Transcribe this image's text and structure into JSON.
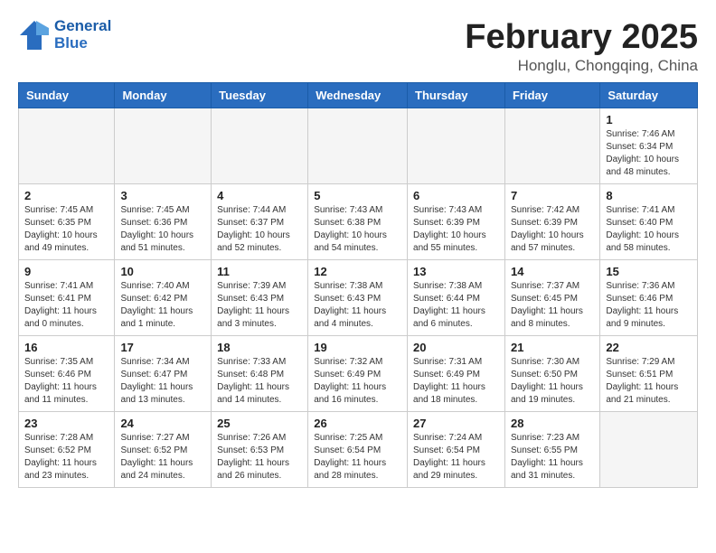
{
  "logo": {
    "line1": "General",
    "line2": "Blue"
  },
  "title": "February 2025",
  "subtitle": "Honglu, Chongqing, China",
  "days_of_week": [
    "Sunday",
    "Monday",
    "Tuesday",
    "Wednesday",
    "Thursday",
    "Friday",
    "Saturday"
  ],
  "weeks": [
    [
      {
        "num": "",
        "info": ""
      },
      {
        "num": "",
        "info": ""
      },
      {
        "num": "",
        "info": ""
      },
      {
        "num": "",
        "info": ""
      },
      {
        "num": "",
        "info": ""
      },
      {
        "num": "",
        "info": ""
      },
      {
        "num": "1",
        "info": "Sunrise: 7:46 AM\nSunset: 6:34 PM\nDaylight: 10 hours\nand 48 minutes."
      }
    ],
    [
      {
        "num": "2",
        "info": "Sunrise: 7:45 AM\nSunset: 6:35 PM\nDaylight: 10 hours\nand 49 minutes."
      },
      {
        "num": "3",
        "info": "Sunrise: 7:45 AM\nSunset: 6:36 PM\nDaylight: 10 hours\nand 51 minutes."
      },
      {
        "num": "4",
        "info": "Sunrise: 7:44 AM\nSunset: 6:37 PM\nDaylight: 10 hours\nand 52 minutes."
      },
      {
        "num": "5",
        "info": "Sunrise: 7:43 AM\nSunset: 6:38 PM\nDaylight: 10 hours\nand 54 minutes."
      },
      {
        "num": "6",
        "info": "Sunrise: 7:43 AM\nSunset: 6:39 PM\nDaylight: 10 hours\nand 55 minutes."
      },
      {
        "num": "7",
        "info": "Sunrise: 7:42 AM\nSunset: 6:39 PM\nDaylight: 10 hours\nand 57 minutes."
      },
      {
        "num": "8",
        "info": "Sunrise: 7:41 AM\nSunset: 6:40 PM\nDaylight: 10 hours\nand 58 minutes."
      }
    ],
    [
      {
        "num": "9",
        "info": "Sunrise: 7:41 AM\nSunset: 6:41 PM\nDaylight: 11 hours\nand 0 minutes."
      },
      {
        "num": "10",
        "info": "Sunrise: 7:40 AM\nSunset: 6:42 PM\nDaylight: 11 hours\nand 1 minute."
      },
      {
        "num": "11",
        "info": "Sunrise: 7:39 AM\nSunset: 6:43 PM\nDaylight: 11 hours\nand 3 minutes."
      },
      {
        "num": "12",
        "info": "Sunrise: 7:38 AM\nSunset: 6:43 PM\nDaylight: 11 hours\nand 4 minutes."
      },
      {
        "num": "13",
        "info": "Sunrise: 7:38 AM\nSunset: 6:44 PM\nDaylight: 11 hours\nand 6 minutes."
      },
      {
        "num": "14",
        "info": "Sunrise: 7:37 AM\nSunset: 6:45 PM\nDaylight: 11 hours\nand 8 minutes."
      },
      {
        "num": "15",
        "info": "Sunrise: 7:36 AM\nSunset: 6:46 PM\nDaylight: 11 hours\nand 9 minutes."
      }
    ],
    [
      {
        "num": "16",
        "info": "Sunrise: 7:35 AM\nSunset: 6:46 PM\nDaylight: 11 hours\nand 11 minutes."
      },
      {
        "num": "17",
        "info": "Sunrise: 7:34 AM\nSunset: 6:47 PM\nDaylight: 11 hours\nand 13 minutes."
      },
      {
        "num": "18",
        "info": "Sunrise: 7:33 AM\nSunset: 6:48 PM\nDaylight: 11 hours\nand 14 minutes."
      },
      {
        "num": "19",
        "info": "Sunrise: 7:32 AM\nSunset: 6:49 PM\nDaylight: 11 hours\nand 16 minutes."
      },
      {
        "num": "20",
        "info": "Sunrise: 7:31 AM\nSunset: 6:49 PM\nDaylight: 11 hours\nand 18 minutes."
      },
      {
        "num": "21",
        "info": "Sunrise: 7:30 AM\nSunset: 6:50 PM\nDaylight: 11 hours\nand 19 minutes."
      },
      {
        "num": "22",
        "info": "Sunrise: 7:29 AM\nSunset: 6:51 PM\nDaylight: 11 hours\nand 21 minutes."
      }
    ],
    [
      {
        "num": "23",
        "info": "Sunrise: 7:28 AM\nSunset: 6:52 PM\nDaylight: 11 hours\nand 23 minutes."
      },
      {
        "num": "24",
        "info": "Sunrise: 7:27 AM\nSunset: 6:52 PM\nDaylight: 11 hours\nand 24 minutes."
      },
      {
        "num": "25",
        "info": "Sunrise: 7:26 AM\nSunset: 6:53 PM\nDaylight: 11 hours\nand 26 minutes."
      },
      {
        "num": "26",
        "info": "Sunrise: 7:25 AM\nSunset: 6:54 PM\nDaylight: 11 hours\nand 28 minutes."
      },
      {
        "num": "27",
        "info": "Sunrise: 7:24 AM\nSunset: 6:54 PM\nDaylight: 11 hours\nand 29 minutes."
      },
      {
        "num": "28",
        "info": "Sunrise: 7:23 AM\nSunset: 6:55 PM\nDaylight: 11 hours\nand 31 minutes."
      },
      {
        "num": "",
        "info": ""
      }
    ]
  ]
}
